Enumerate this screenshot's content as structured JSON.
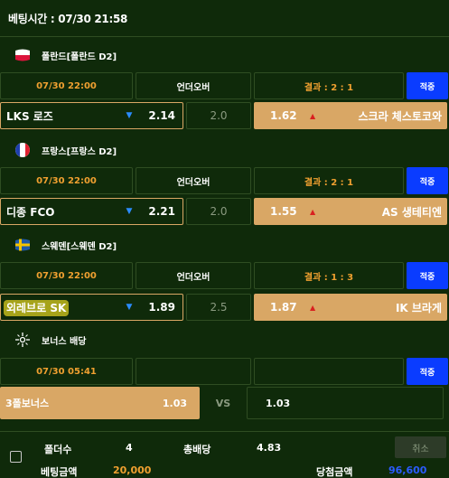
{
  "header": {
    "betting_time": "베팅시간 : 07/30 21:58"
  },
  "matches": [
    {
      "league": "폴란드[폴란드 D2]",
      "flag_icon": "poland-flag-icon",
      "time": "07/30 22:00",
      "market": "언더오버",
      "result": "결과 : 2 : 1",
      "button": "적중",
      "home": "LKS 로즈",
      "home_odds": "2.14",
      "line": "2.0",
      "away_odds": "1.62",
      "away": "스크라 체스토코와",
      "highlight_home": false
    },
    {
      "league": "프랑스[프랑스 D2]",
      "flag_icon": "france-flag-icon",
      "time": "07/30 22:00",
      "market": "언더오버",
      "result": "결과 : 2 : 1",
      "button": "적중",
      "home": "디종 FCO",
      "home_odds": "2.21",
      "line": "2.0",
      "away_odds": "1.55",
      "away": "AS 생테티엔",
      "highlight_home": false
    },
    {
      "league": "스웨덴[스웨덴 D2]",
      "flag_icon": "sweden-flag-icon",
      "time": "07/30 22:00",
      "market": "언더오버",
      "result": "결과 : 1 : 3",
      "button": "적중",
      "home": "외레브로 SK",
      "home_odds": "1.89",
      "line": "2.5",
      "away_odds": "1.87",
      "away": "IK 브라게",
      "highlight_home": true
    }
  ],
  "bonus": {
    "label": "보너스 배당",
    "icon": "bonus-sparkle-icon",
    "time": "07/30 05:41",
    "button": "적중",
    "name": "3폴보너스",
    "odds": "1.03",
    "vs": "VS",
    "right_odds": "1.03"
  },
  "footer": {
    "folders_label": "폴더수",
    "folders_value": "4",
    "total_odds_label": "총배당",
    "total_odds_value": "4.83",
    "cancel_label": "취소",
    "bet_amount_label": "베팅금액",
    "bet_amount_value": "20,000",
    "win_amount_label": "당첨금액",
    "win_amount_value": "96,600"
  },
  "colors": {
    "background": "#0f2a0a",
    "accent_orange": "#f0a030",
    "gold": "#d9a765",
    "blue_button": "#0a3cff",
    "arrow_up": "#d92020",
    "arrow_down": "#2b8cff"
  }
}
